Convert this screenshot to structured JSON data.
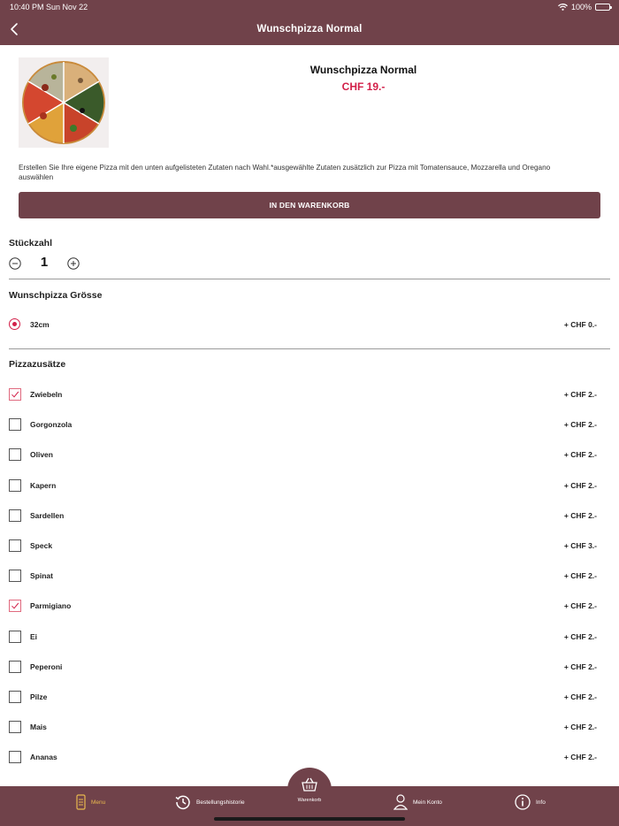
{
  "status": {
    "time": "10:40 PM",
    "date": "Sun Nov 22",
    "battery": "100%"
  },
  "header": {
    "title": "Wunschpizza Normal"
  },
  "product": {
    "name": "Wunschpizza Normal",
    "price": "CHF 19.-",
    "description": "Erstellen Sie Ihre eigene Pizza mit den unten aufgelisteten Zutaten nach Wahl.*ausgewählte Zutaten zusätzlich zur Pizza mit Tomatensauce, Mozzarella und Oregano auswählen"
  },
  "cart_button": {
    "label": "IN DEN WARENKORB"
  },
  "quantity": {
    "title": "Stückzahl",
    "value": "1"
  },
  "size": {
    "title": "Wunschpizza Grösse",
    "options": [
      {
        "label": "32cm",
        "price": "+ CHF 0.-",
        "selected": true
      }
    ]
  },
  "extras": {
    "title": "Pizzazusätze",
    "items": [
      {
        "label": "Zwiebeln",
        "price": "+ CHF 2.-",
        "checked": true
      },
      {
        "label": "Gorgonzola",
        "price": "+ CHF 2.-",
        "checked": false
      },
      {
        "label": "Oliven",
        "price": "+ CHF 2.-",
        "checked": false
      },
      {
        "label": "Kapern",
        "price": "+ CHF 2.-",
        "checked": false
      },
      {
        "label": "Sardellen",
        "price": "+ CHF 2.-",
        "checked": false
      },
      {
        "label": "Speck",
        "price": "+ CHF 3.-",
        "checked": false
      },
      {
        "label": "Spinat",
        "price": "+ CHF 2.-",
        "checked": false
      },
      {
        "label": "Parmigiano",
        "price": "+ CHF 2.-",
        "checked": true
      },
      {
        "label": "Ei",
        "price": "+ CHF 2.-",
        "checked": false
      },
      {
        "label": "Peperoni",
        "price": "+ CHF 2.-",
        "checked": false
      },
      {
        "label": "Pilze",
        "price": "+ CHF 2.-",
        "checked": false
      },
      {
        "label": "Mais",
        "price": "+ CHF 2.-",
        "checked": false
      },
      {
        "label": "Ananas",
        "price": "+ CHF 2.-",
        "checked": false
      }
    ]
  },
  "tabbar": {
    "menu": "Menu",
    "history": "Bestellungshistorie",
    "cart": "Warenkorb",
    "account": "Mein Konto",
    "info": "Info"
  },
  "colors": {
    "brand": "#70424a",
    "accent": "#d21f48",
    "active_tab": "#e8b84e"
  }
}
